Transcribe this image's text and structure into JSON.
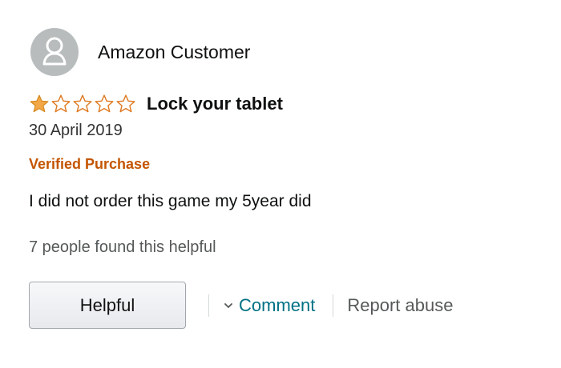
{
  "profile": {
    "name": "Amazon Customer",
    "avatar_icon": "user-silhouette-icon"
  },
  "review": {
    "rating": 1,
    "rating_max": 5,
    "star_filled_color": "#f3a847",
    "star_empty_color": "#de7921",
    "title": "Lock your tablet",
    "date": "30 April 2019",
    "verified_label": "Verified Purchase",
    "verified_color": "#c45500",
    "body": "I did not order this game my 5year did",
    "helpful_count_text": "7 people found this helpful"
  },
  "actions": {
    "helpful_label": "Helpful",
    "comment_label": "Comment",
    "comment_icon": "chevron-down-icon",
    "report_label": "Report abuse",
    "link_color": "#007185"
  }
}
